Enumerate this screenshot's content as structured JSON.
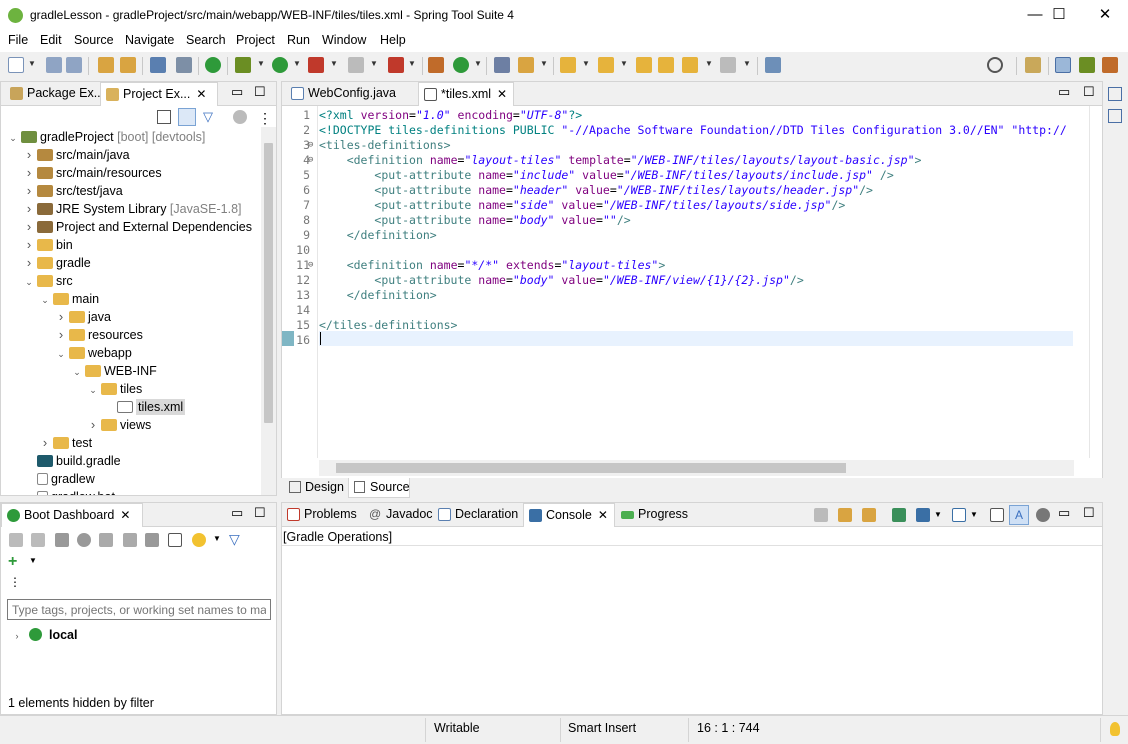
{
  "window": {
    "title": "gradleLesson - gradleProject/src/main/webapp/WEB-INF/tiles/tiles.xml - Spring Tool Suite 4",
    "minimize": "—",
    "maximize": "☐",
    "close": "✕"
  },
  "menu": [
    "File",
    "Edit",
    "Source",
    "Navigate",
    "Search",
    "Project",
    "Run",
    "Window",
    "Help"
  ],
  "left_tabs": {
    "package_explorer": "Package Ex...",
    "project_explorer": "Project Ex..."
  },
  "tree": [
    {
      "label": "gradleProject",
      "extra": "[boot] [devtools]",
      "indent": 0,
      "icon": "project",
      "twisty": "open"
    },
    {
      "label": "src/main/java",
      "extra": "",
      "indent": 1,
      "icon": "pkg",
      "twisty": "closed"
    },
    {
      "label": "src/main/resources",
      "extra": "",
      "indent": 1,
      "icon": "pkg",
      "twisty": "closed"
    },
    {
      "label": "src/test/java",
      "extra": "",
      "indent": 1,
      "icon": "pkg",
      "twisty": "closed"
    },
    {
      "label": "JRE System Library",
      "extra": "[JavaSE-1.8]",
      "indent": 1,
      "icon": "jar",
      "twisty": "closed"
    },
    {
      "label": "Project and External Dependencies",
      "extra": "",
      "indent": 1,
      "icon": "jar",
      "twisty": "closed"
    },
    {
      "label": "bin",
      "extra": "",
      "indent": 1,
      "icon": "fold",
      "twisty": "closed"
    },
    {
      "label": "gradle",
      "extra": "",
      "indent": 1,
      "icon": "fold",
      "twisty": "closed"
    },
    {
      "label": "src",
      "extra": "",
      "indent": 1,
      "icon": "fold",
      "twisty": "open"
    },
    {
      "label": "main",
      "extra": "",
      "indent": 2,
      "icon": "fold",
      "twisty": "open"
    },
    {
      "label": "java",
      "extra": "",
      "indent": 3,
      "icon": "fold",
      "twisty": "closed"
    },
    {
      "label": "resources",
      "extra": "",
      "indent": 3,
      "icon": "fold",
      "twisty": "closed"
    },
    {
      "label": "webapp",
      "extra": "",
      "indent": 3,
      "icon": "fold",
      "twisty": "open"
    },
    {
      "label": "WEB-INF",
      "extra": "",
      "indent": 4,
      "icon": "fold",
      "twisty": "open"
    },
    {
      "label": "tiles",
      "extra": "",
      "indent": 5,
      "icon": "fold",
      "twisty": "open"
    },
    {
      "label": "tiles.xml",
      "extra": "",
      "indent": 6,
      "icon": "xml",
      "twisty": "none",
      "selected": true
    },
    {
      "label": "views",
      "extra": "",
      "indent": 5,
      "icon": "fold",
      "twisty": "closed"
    },
    {
      "label": "test",
      "extra": "",
      "indent": 2,
      "icon": "fold",
      "twisty": "closed"
    },
    {
      "label": "build.gradle",
      "extra": "",
      "indent": 1,
      "icon": "gradle",
      "twisty": "none"
    },
    {
      "label": "gradlew",
      "extra": "",
      "indent": 1,
      "icon": "file",
      "twisty": "none"
    },
    {
      "label": "gradlew.bat",
      "extra": "",
      "indent": 1,
      "icon": "file",
      "twisty": "none"
    }
  ],
  "editor_tabs": [
    {
      "label": "WebConfig.java"
    },
    {
      "label": "*tiles.xml",
      "active": true
    }
  ],
  "code": [
    {
      "n": "1",
      "fold": "",
      "html": "<span class='p'>&lt;?xml</span> <span class='a'>version</span>=<span class='v'>\"1.0\"</span> <span class='a'>encoding</span>=<span class='v'>\"UTF-8\"</span><span class='p'>?&gt;</span>"
    },
    {
      "n": "2",
      "fold": "",
      "html": "<span class='p'>&lt;!DOCTYPE tiles-definitions</span> <span class='p'>PUBLIC</span> <span class='v' style='font-style:normal'>\"-//Apache Software Foundation//DTD Tiles Configuration 3.0//EN\"</span> <span class='v' style='font-style:normal'>\"http://</span>"
    },
    {
      "n": "3",
      "fold": "⊖",
      "html": "<span class='k'>&lt;tiles-definitions&gt;</span>"
    },
    {
      "n": "4",
      "fold": "⊖",
      "html": "    <span class='k'>&lt;definition</span> <span class='a'>name</span>=<span class='v'>\"layout-tiles\"</span> <span class='a'>template</span>=<span class='v'>\"/WEB-INF/tiles/layouts/layout-basic.jsp\"</span><span class='k'>&gt;</span>"
    },
    {
      "n": "5",
      "fold": "",
      "html": "        <span class='k'>&lt;put-attribute</span> <span class='a'>name</span>=<span class='v'>\"include\"</span> <span class='a'>value</span>=<span class='v'>\"/WEB-INF/tiles/layouts/include.jsp\"</span> <span class='k'>/&gt;</span>"
    },
    {
      "n": "6",
      "fold": "",
      "html": "        <span class='k'>&lt;put-attribute</span> <span class='a'>name</span>=<span class='v'>\"header\"</span> <span class='a'>value</span>=<span class='v'>\"/WEB-INF/tiles/layouts/header.jsp\"</span><span class='k'>/&gt;</span>"
    },
    {
      "n": "7",
      "fold": "",
      "html": "        <span class='k'>&lt;put-attribute</span> <span class='a'>name</span>=<span class='v'>\"side\"</span> <span class='a'>value</span>=<span class='v'>\"/WEB-INF/tiles/layouts/side.jsp\"</span><span class='k'>/&gt;</span>"
    },
    {
      "n": "8",
      "fold": "",
      "html": "        <span class='k'>&lt;put-attribute</span> <span class='a'>name</span>=<span class='v'>\"body\"</span> <span class='a'>value</span>=<span class='v'>\"\"</span><span class='k'>/&gt;</span>"
    },
    {
      "n": "9",
      "fold": "",
      "html": "    <span class='k'>&lt;/definition&gt;</span>"
    },
    {
      "n": "10",
      "fold": "",
      "html": ""
    },
    {
      "n": "11",
      "fold": "⊖",
      "html": "    <span class='k'>&lt;definition</span> <span class='a'>name</span>=<span class='v'>\"*/*\"</span> <span class='a'>extends</span>=<span class='v'>\"layout-tiles\"</span><span class='k'>&gt;</span>"
    },
    {
      "n": "12",
      "fold": "",
      "html": "        <span class='k'>&lt;put-attribute</span> <span class='a'>name</span>=<span class='v'>\"body\"</span> <span class='a'>value</span>=<span class='v'>\"/WEB-INF/view/{1}/{2}.jsp\"</span><span class='k'>/&gt;</span>"
    },
    {
      "n": "13",
      "fold": "",
      "html": "    <span class='k'>&lt;/definition&gt;</span>"
    },
    {
      "n": "14",
      "fold": "",
      "html": ""
    },
    {
      "n": "15",
      "fold": "",
      "html": "<span class='k'>&lt;/tiles-definitions&gt;</span>"
    },
    {
      "n": "16",
      "fold": "",
      "html": ""
    }
  ],
  "editor_bottom_tabs": {
    "design": "Design",
    "source": "Source"
  },
  "boot_dashboard": {
    "tab": "Boot Dashboard",
    "filter_placeholder": "Type tags, projects, or working set names to match",
    "local": "local",
    "hidden": "1 elements hidden by filter"
  },
  "bottom_tabs": {
    "problems": "Problems",
    "javadoc": "Javadoc",
    "declaration": "Declaration",
    "console": "Console",
    "progress": "Progress"
  },
  "console_text": "[Gradle Operations]",
  "status": {
    "writable": "Writable",
    "insert": "Smart Insert",
    "position": "16 : 1 : 744"
  }
}
